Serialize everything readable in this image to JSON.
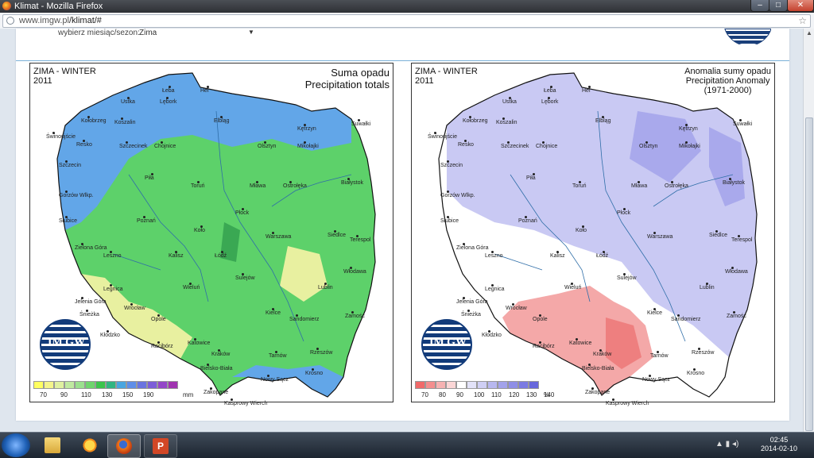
{
  "window": {
    "title": "Klimat - Mozilla Firefox",
    "minimize": "–",
    "maximize": "□",
    "close": "✕"
  },
  "address_bar": {
    "domain": "www.imgw.pl",
    "path": "/klimat/#",
    "favicon": "globe-icon",
    "bookmark_icon": "star-icon"
  },
  "selector": {
    "label": "wybierz miesiąc/sezon:",
    "value": "Zima"
  },
  "left_map": {
    "season": "ZIMA - WINTER",
    "year": "2011",
    "heading_line1": "Suma opadu",
    "heading_line2": "Precipitation totals",
    "legend_ticks": [
      "70",
      "90",
      "110",
      "130",
      "150",
      "190"
    ],
    "legend_unit": "mm",
    "legend_colors": [
      "#ffff60",
      "#f4f48a",
      "#dff0a0",
      "#bfe9a0",
      "#9be08e",
      "#6fd46d",
      "#3cc44c",
      "#32b582",
      "#4aa6e0",
      "#5f8ee8",
      "#6a74e0",
      "#7c5ed8",
      "#9447c8",
      "#a034b0"
    ],
    "palette": {
      "main": "#5dd16a",
      "north": "#62a6e8",
      "south": "#e8f0a0",
      "dark": "#3aa853"
    }
  },
  "right_map": {
    "season": "ZIMA - WINTER",
    "year": "2011",
    "heading_line1": "Anomalia sumy opadu",
    "heading_line2": "Precipitation Anomaly",
    "heading_line3": "(1971-2000)",
    "legend_ticks": [
      "70",
      "80",
      "90",
      "100",
      "110",
      "120",
      "130",
      "140"
    ],
    "legend_unit": "%",
    "legend_colors": [
      "#f06a6a",
      "#f38e8e",
      "#f6b2b2",
      "#fbd6d6",
      "#ffffff",
      "#e2e2f8",
      "#cfcff4",
      "#b8b8ef",
      "#a3a3ea",
      "#8f8fe6",
      "#7b7be2",
      "#6868dc"
    ],
    "palette": {
      "base": "#ffffff",
      "blue": "#c9c9f3",
      "blue2": "#a9a9ec",
      "red": "#f4a8a8",
      "red2": "#ee7f7f"
    }
  },
  "cities": [
    "Hel",
    "Łeba",
    "Ustka",
    "Lębork",
    "Kołobrzeg",
    "Koszalin",
    "Elbląg",
    "Kętrzyn",
    "Suwałki",
    "Świnoujście",
    "Resko",
    "Szczecinek",
    "Chojnice",
    "Olsztyn",
    "Mikołajki",
    "Szczecin",
    "Piła",
    "Toruń",
    "Mława",
    "Ostrołęka",
    "Białystok",
    "Gorzów Wlkp.",
    "Płock",
    "Słubice",
    "Poznań",
    "Koło",
    "Warszawa",
    "Siedlce",
    "Terespol",
    "Zielona Góra",
    "Leszno",
    "Łódź",
    "Kalisz",
    "Sulejów",
    "Włodawa",
    "Wieluń",
    "Legnica",
    "Lublin",
    "Jelenia Góra",
    "Śnieżka",
    "Wrocław",
    "Kielce",
    "Opole",
    "Sandomierz",
    "Zamość",
    "Kłodzko",
    "Racibórz",
    "Katowice",
    "Kraków",
    "Tarnów",
    "Rzeszów",
    "Bielsko-Biała",
    "Nowy Sącz",
    "Krosno",
    "Zakopane",
    "Kasprowy Wierch"
  ],
  "logo_text": "IM GW",
  "taskbar": {
    "time": "02:45",
    "date": "2014-02-10",
    "items": [
      "start-icon",
      "explorer-icon",
      "sun-icon",
      "firefox-icon",
      "powerpoint-icon"
    ]
  }
}
